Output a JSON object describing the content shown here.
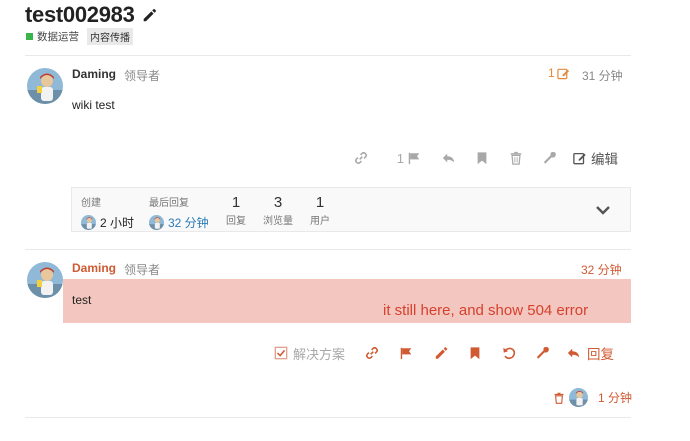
{
  "topic": {
    "title": "test002983",
    "category": "数据运营",
    "tag": "内容传播"
  },
  "post1": {
    "username": "Daming",
    "role": "领导者",
    "edit_count": "1",
    "time": "31 分钟",
    "body": "wiki test",
    "like_count": "1",
    "edit_label": "编辑"
  },
  "summary": {
    "created_label": "创建",
    "created_value": "2 小时",
    "last_reply_label": "最后回复",
    "last_reply_value": "32 分钟",
    "replies_value": "1",
    "replies_label": "回复",
    "views_value": "3",
    "views_label": "浏览量",
    "users_value": "1",
    "users_label": "用户"
  },
  "post2": {
    "username": "Daming",
    "role": "领导者",
    "time": "32 分钟",
    "body": "test",
    "annotation": "it still here, and show 504 error",
    "solution_label": "解决方案",
    "reply_label": "回复"
  },
  "deleted_row": {
    "time": "1 分钟"
  },
  "colors": {
    "accent": "#d05a32",
    "muted": "#9a9a9a",
    "highlight": "#f3c7bf",
    "annotation": "#d6402e",
    "category": "#3ab54a"
  }
}
